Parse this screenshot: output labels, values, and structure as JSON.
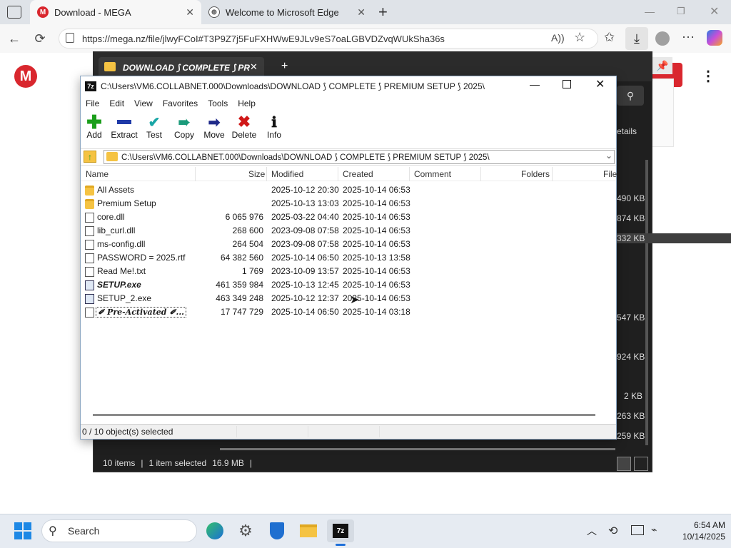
{
  "browser": {
    "tabs": [
      {
        "label": "Download - MEGA",
        "active": true
      },
      {
        "label": "Welcome to Microsoft Edge",
        "active": false
      }
    ],
    "new_tab": "+",
    "url": "https://mega.nz/file/jlwyFCoI#T3P9Z7j5FuFXHWwE9JLv9eS7oaLGBVDZvqWUkSha36s"
  },
  "mega": {
    "logo_letter": "M",
    "dark_tab_title": "DOWNLOAD ⟆ COMPLETE ⟆ PR",
    "details_label": "etails",
    "side_sizes": [
      "490 KB",
      "874 KB",
      "332 KB",
      "547 KB",
      "924 KB",
      "2 KB",
      "263 KB",
      "259 KB"
    ],
    "status_items": "10 items",
    "status_selected": "1 item selected",
    "status_size": "16.9 MB"
  },
  "sevenzip": {
    "title": "C:\\Users\\VM6.COLLABNET.000\\Downloads\\DOWNLOAD ⟆ COMPLETE ⟆ PREMIUM SETUP ⟆ 2025\\",
    "menu": [
      "File",
      "Edit",
      "View",
      "Favorites",
      "Tools",
      "Help"
    ],
    "toolbar": [
      {
        "label": "Add",
        "icon": "plus-icon",
        "color": "#1a9e1a"
      },
      {
        "label": "Extract",
        "icon": "minus-icon",
        "color": "#1f3aa8"
      },
      {
        "label": "Test",
        "icon": "check-icon",
        "color": "#1aa6a6"
      },
      {
        "label": "Copy",
        "icon": "double-arrow-icon",
        "color": "#1a9a7a"
      },
      {
        "label": "Move",
        "icon": "arrow-right-icon",
        "color": "#1f2a8a"
      },
      {
        "label": "Delete",
        "icon": "x-icon",
        "color": "#d01818"
      },
      {
        "label": "Info",
        "icon": "info-icon",
        "color": "#222222"
      }
    ],
    "path": "C:\\Users\\VM6.COLLABNET.000\\Downloads\\DOWNLOAD ⟆ COMPLETE ⟆ PREMIUM SETUP ⟆ 2025\\",
    "columns": [
      "Name",
      "Size",
      "Modified",
      "Created",
      "Comment",
      "Folders",
      "File"
    ],
    "rows": [
      {
        "name": "All Assets",
        "size": "",
        "modified": "2025-10-12 20:30",
        "created": "2025-10-14 06:53",
        "type": "folder"
      },
      {
        "name": "Premium Setup",
        "size": "",
        "modified": "2025-10-13 13:03",
        "created": "2025-10-14 06:53",
        "type": "folder"
      },
      {
        "name": "core.dll",
        "size": "6 065 976",
        "modified": "2025-03-22 04:40",
        "created": "2025-10-14 06:53",
        "type": "file"
      },
      {
        "name": "lib_curl.dll",
        "size": "268 600",
        "modified": "2023-09-08 07:58",
        "created": "2025-10-14 06:53",
        "type": "file"
      },
      {
        "name": "ms-config.dll",
        "size": "264 504",
        "modified": "2023-09-08 07:58",
        "created": "2025-10-14 06:53",
        "type": "file"
      },
      {
        "name": "PASSWORD =  2025.rtf",
        "size": "64 382 560",
        "modified": "2025-10-14 06:50",
        "created": "2025-10-13 13:58",
        "type": "file"
      },
      {
        "name": "Read Me!.txt",
        "size": "1 769",
        "modified": "2023-10-09 13:57",
        "created": "2025-10-14 06:53",
        "type": "file"
      },
      {
        "name": "SETUP.exe",
        "size": "461 359 984",
        "modified": "2025-10-13 12:45",
        "created": "2025-10-14 06:53",
        "type": "exe"
      },
      {
        "name": "SETUP_2.exe",
        "size": "463 349 248",
        "modified": "2025-10-12 12:37",
        "created": "2025-10-14 06:53",
        "type": "exe"
      },
      {
        "name": "✐ Pre-Activated ✐...",
        "size": "17 747 729",
        "modified": "2025-10-14 06:50",
        "created": "2025-10-14 03:18",
        "type": "file"
      }
    ],
    "status": "0 / 10 object(s) selected"
  },
  "taskbar": {
    "search_placeholder": "Search",
    "time": "6:54 AM",
    "date": "10/14/2025"
  }
}
